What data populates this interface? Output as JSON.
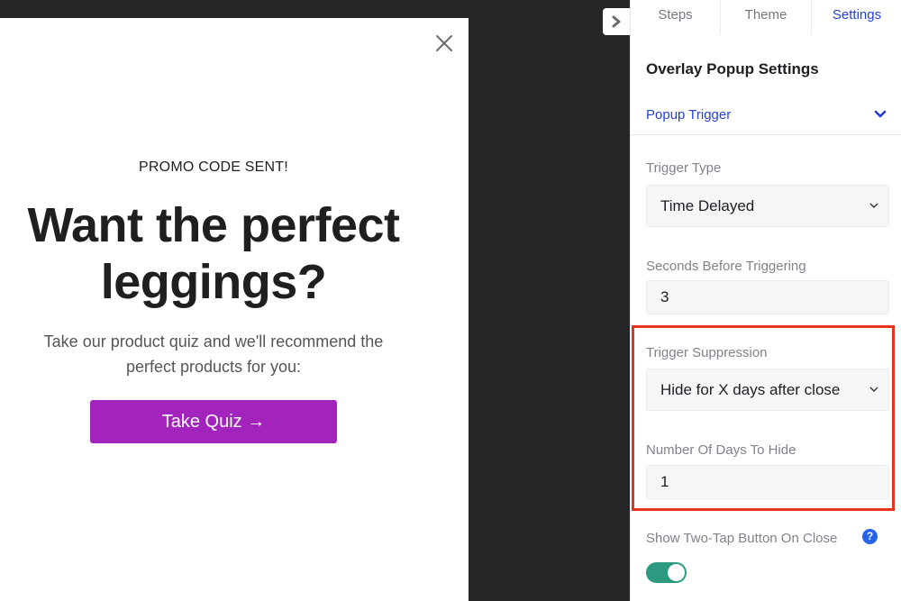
{
  "preview": {
    "eyebrow": "PROMO CODE SENT!",
    "headline_line1": "Want the perfect",
    "headline_line2": "leggings?",
    "subtext_line1": "Take our product quiz and we'll recommend the",
    "subtext_line2": "perfect products for you:",
    "button_label": "Take Quiz →"
  },
  "panel": {
    "tabs": [
      {
        "label": "Steps"
      },
      {
        "label": "Theme"
      },
      {
        "label": "Settings",
        "active": true
      }
    ],
    "title": "Overlay Popup Settings",
    "section": "Popup Trigger",
    "trigger_type": {
      "label": "Trigger Type",
      "value": "Time Delayed"
    },
    "seconds": {
      "label": "Seconds Before Triggering",
      "value": "3"
    },
    "suppression": {
      "label": "Trigger Suppression",
      "value": "Hide for X days after close"
    },
    "days_to_hide": {
      "label": "Number Of Days To Hide",
      "value": "1"
    },
    "two_tap": {
      "label": "Show Two-Tap Button On Close",
      "help": "?",
      "enabled": true
    }
  },
  "colors": {
    "accent": "#2441d6",
    "quiz_button": "#a323bd",
    "toggle_on": "#2b9a80",
    "highlight": "#e8341c",
    "help_icon": "#2463eb"
  }
}
